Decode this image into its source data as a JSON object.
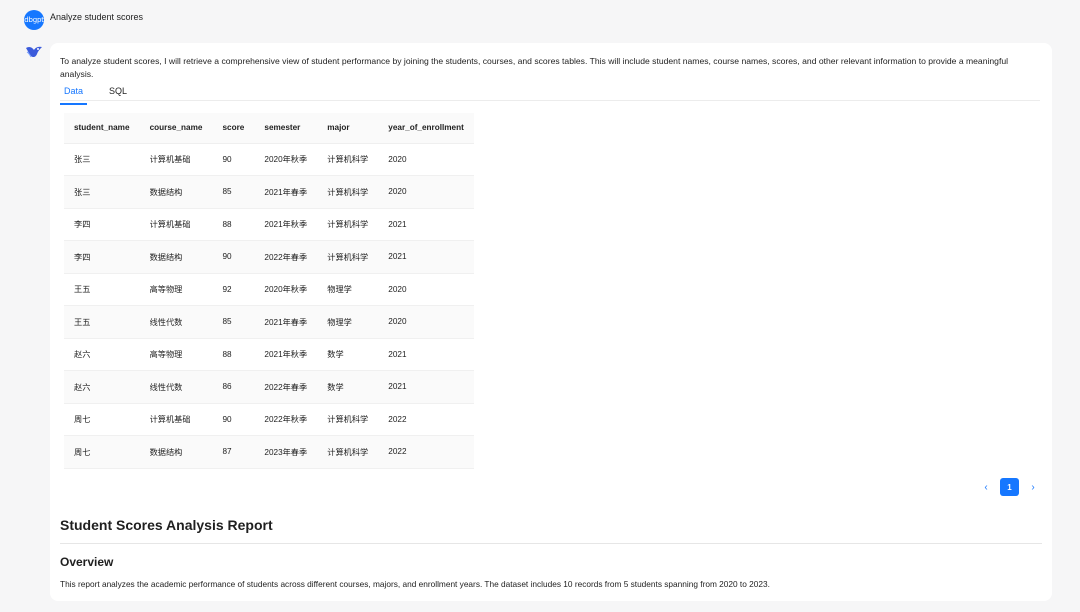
{
  "user": {
    "avatar_label": "dbgpt",
    "message": "Analyze student scores"
  },
  "response": {
    "intro": "To analyze student scores, I will retrieve a comprehensive view of student performance by joining the students, courses, and scores tables. This will include student names, course names, scores, and other relevant information to provide a meaningful analysis.",
    "tabs": [
      {
        "label": "Data",
        "active": true
      },
      {
        "label": "SQL",
        "active": false
      }
    ],
    "table": {
      "columns": [
        "student_name",
        "course_name",
        "score",
        "semester",
        "major",
        "year_of_enrollment"
      ],
      "rows": [
        [
          "张三",
          "计算机基础",
          "90",
          "2020年秋季",
          "计算机科学",
          "2020"
        ],
        [
          "张三",
          "数据结构",
          "85",
          "2021年春季",
          "计算机科学",
          "2020"
        ],
        [
          "李四",
          "计算机基础",
          "88",
          "2021年秋季",
          "计算机科学",
          "2021"
        ],
        [
          "李四",
          "数据结构",
          "90",
          "2022年春季",
          "计算机科学",
          "2021"
        ],
        [
          "王五",
          "高等物理",
          "92",
          "2020年秋季",
          "物理学",
          "2020"
        ],
        [
          "王五",
          "线性代数",
          "85",
          "2021年春季",
          "物理学",
          "2020"
        ],
        [
          "赵六",
          "高等物理",
          "88",
          "2021年秋季",
          "数学",
          "2021"
        ],
        [
          "赵六",
          "线性代数",
          "86",
          "2022年春季",
          "数学",
          "2021"
        ],
        [
          "周七",
          "计算机基础",
          "90",
          "2022年秋季",
          "计算机科学",
          "2022"
        ],
        [
          "周七",
          "数据结构",
          "87",
          "2023年春季",
          "计算机科学",
          "2022"
        ]
      ]
    },
    "pagination": {
      "prev_icon": "chevron-left-icon",
      "next_icon": "chevron-right-icon",
      "current_page": "1"
    },
    "report": {
      "title": "Student Scores Analysis Report",
      "overview_title": "Overview",
      "overview_text": "This report analyzes the academic performance of students across different courses, majors, and enrollment years. The dataset includes 10 records from 5 students spanning from 2020 to 2023."
    }
  },
  "colors": {
    "accent": "#1677ff",
    "background": "#f6f6f7",
    "card": "#ffffff"
  }
}
